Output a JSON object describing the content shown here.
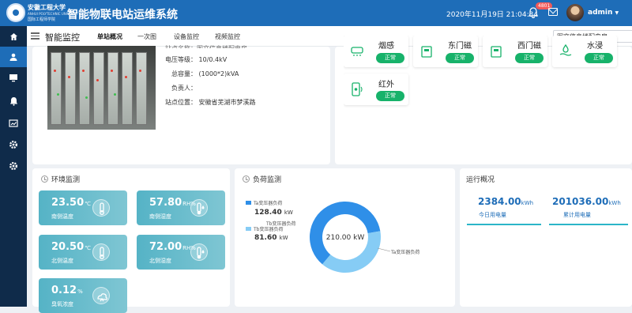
{
  "header": {
    "school_cn": "安徽工程大学",
    "school_en": "ANHUI POLYTECHNIC UNIVERSITY",
    "school_sub": "国际工程师学院",
    "system_name": "智能物联电站运维系统",
    "datetime": "2020年11月19日 21:04:34",
    "notification_count": "4801",
    "username": "admin"
  },
  "sidebar": {
    "items": [
      {
        "icon": "home-icon"
      },
      {
        "icon": "monitor-people-icon"
      },
      {
        "icon": "screen-icon"
      },
      {
        "icon": "bell-icon"
      },
      {
        "icon": "chart-icon"
      },
      {
        "icon": "gear-icon"
      },
      {
        "icon": "settings-icon"
      }
    ]
  },
  "tabbar": {
    "title": "智能监控",
    "tabs": [
      {
        "label": "单站概况",
        "active": true
      },
      {
        "label": "一次图",
        "active": false
      },
      {
        "label": "设备监控",
        "active": false
      },
      {
        "label": "视频监控",
        "active": false
      }
    ],
    "station_select": "图文信息楼配电房"
  },
  "station_info": {
    "partial_line": "站点名称：图文信息楼配电房",
    "voltage": "电压等级：  10/0.4kV",
    "capacity": "总容量：  (1000*2)kVA",
    "manager": "负责人：",
    "location": "站点位置：  安徽省芜湖市梦溪路"
  },
  "sensors": [
    {
      "name": "烟感",
      "status": "正常",
      "icon": "smoke-sensor-icon"
    },
    {
      "name": "东门磁",
      "status": "正常",
      "icon": "door-sensor-icon"
    },
    {
      "name": "西门磁",
      "status": "正常",
      "icon": "door-sensor-icon"
    },
    {
      "name": "水浸",
      "status": "正常",
      "icon": "water-sensor-icon"
    },
    {
      "name": "红外",
      "status": "正常",
      "icon": "infrared-sensor-icon"
    }
  ],
  "environment": {
    "title": "环境监测",
    "items": [
      {
        "value": "23.50",
        "unit": "℃",
        "label": "南侧温度",
        "icon": "thermometer-icon"
      },
      {
        "value": "57.80",
        "unit": "RH%",
        "label": "南侧湿度",
        "icon": "humidity-icon"
      },
      {
        "value": "20.50",
        "unit": "℃",
        "label": "北侧温度",
        "icon": "thermometer-icon"
      },
      {
        "value": "72.00",
        "unit": "RH%",
        "label": "北侧湿度",
        "icon": "humidity-icon"
      },
      {
        "value": "0.12",
        "unit": "%",
        "label": "臭氧浓度",
        "icon": "ozone-icon"
      }
    ]
  },
  "load": {
    "title": "负荷监测",
    "center_label": "210.00 kW",
    "legend": [
      {
        "name": "Ta变压器负荷",
        "value": "128.40",
        "unit": "kW",
        "color": "#2f8fe8"
      },
      {
        "name": "Tb变压器负荷",
        "value": "81.60",
        "unit": "kW",
        "color": "#86ccf5"
      }
    ],
    "slice_label_a": "Ta变压器负荷",
    "slice_label_b": "Tb变压器负荷"
  },
  "chart_data": {
    "type": "pie",
    "categories": [
      "Ta变压器负荷",
      "Tb变压器负荷"
    ],
    "values": [
      128.4,
      81.6
    ],
    "unit": "kW",
    "total": 210.0,
    "colors": [
      "#2f8fe8",
      "#86ccf5"
    ]
  },
  "operation": {
    "title": "运行概况",
    "today": {
      "value": "2384.00",
      "unit": "kWh",
      "label": "今日用电量"
    },
    "total": {
      "value": "201036.00",
      "unit": "kWh",
      "label": "累计用电量"
    }
  }
}
